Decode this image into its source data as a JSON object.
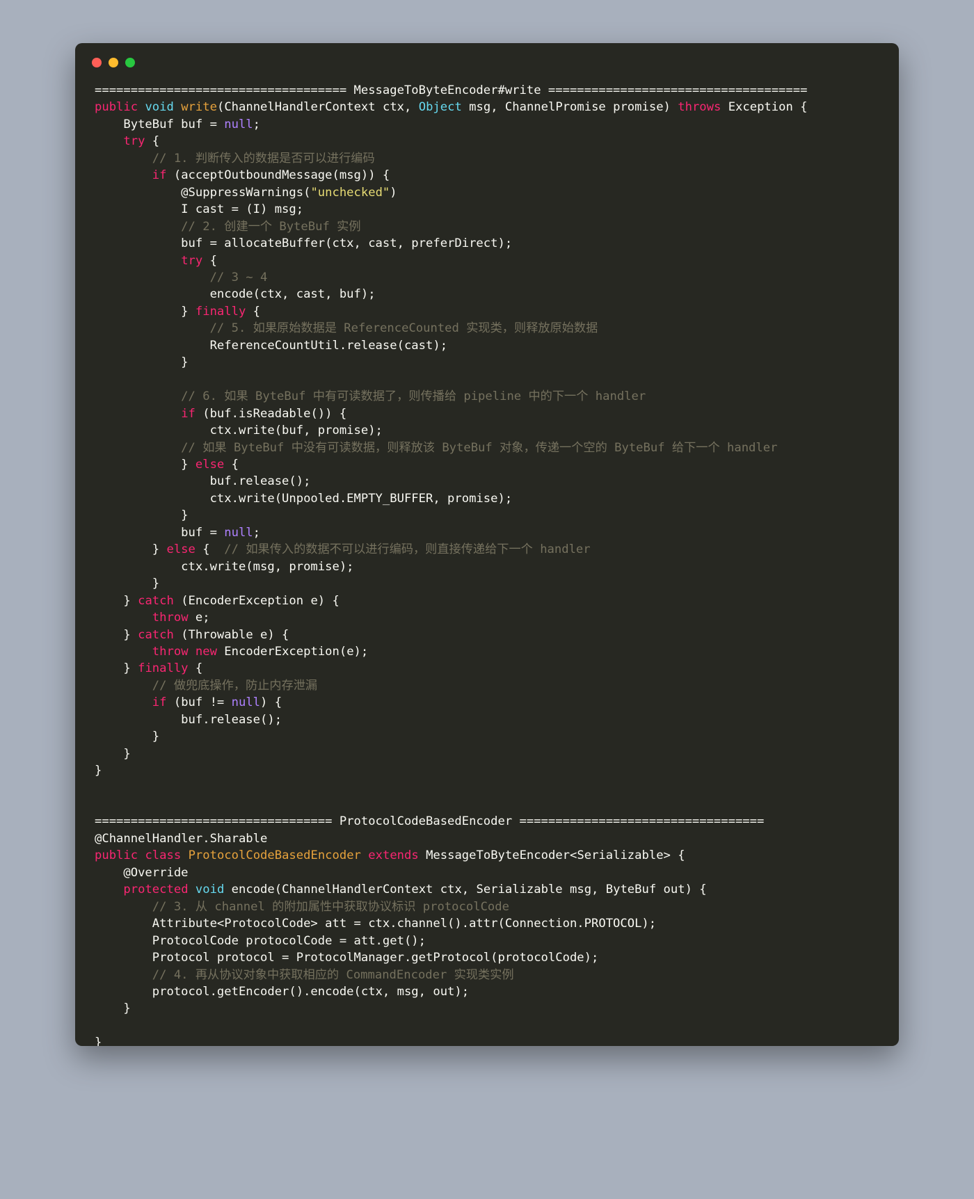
{
  "window": {
    "traffic_lights": [
      "close",
      "minimize",
      "zoom"
    ]
  },
  "code": {
    "lines": [
      {
        "id": "l1",
        "segments": [
          {
            "t": "=================================== MessageToByteEncoder#write ====================================",
            "c": "pl"
          }
        ]
      },
      {
        "id": "l2",
        "segments": [
          {
            "t": "public",
            "c": "kw"
          },
          {
            "t": " ",
            "c": "pl"
          },
          {
            "t": "void",
            "c": "ty"
          },
          {
            "t": " ",
            "c": "pl"
          },
          {
            "t": "write",
            "c": "fn"
          },
          {
            "t": "(ChannelHandlerContext ctx, ",
            "c": "pl"
          },
          {
            "t": "Object",
            "c": "ty"
          },
          {
            "t": " msg, ChannelPromise promise) ",
            "c": "pl"
          },
          {
            "t": "throws",
            "c": "kw"
          },
          {
            "t": " Exception {",
            "c": "pl"
          }
        ]
      },
      {
        "id": "l3",
        "segments": [
          {
            "t": "    ByteBuf buf = ",
            "c": "pl"
          },
          {
            "t": "null",
            "c": "nl"
          },
          {
            "t": ";",
            "c": "pl"
          }
        ]
      },
      {
        "id": "l4",
        "segments": [
          {
            "t": "    ",
            "c": "pl"
          },
          {
            "t": "try",
            "c": "kw"
          },
          {
            "t": " {",
            "c": "pl"
          }
        ]
      },
      {
        "id": "l5",
        "segments": [
          {
            "t": "        // 1. 判断传入的数据是否可以进行编码",
            "c": "cm"
          }
        ]
      },
      {
        "id": "l6",
        "segments": [
          {
            "t": "        ",
            "c": "pl"
          },
          {
            "t": "if",
            "c": "kw"
          },
          {
            "t": " (acceptOutboundMessage(msg)) {",
            "c": "pl"
          }
        ]
      },
      {
        "id": "l7",
        "segments": [
          {
            "t": "            @SuppressWarnings(",
            "c": "pl"
          },
          {
            "t": "\"unchecked\"",
            "c": "st"
          },
          {
            "t": ")",
            "c": "pl"
          }
        ]
      },
      {
        "id": "l8",
        "segments": [
          {
            "t": "            I cast = (I) msg;",
            "c": "pl"
          }
        ]
      },
      {
        "id": "l9",
        "segments": [
          {
            "t": "            // 2. 创建一个 ByteBuf 实例",
            "c": "cm"
          }
        ]
      },
      {
        "id": "l10",
        "segments": [
          {
            "t": "            buf = allocateBuffer(ctx, cast, preferDirect);",
            "c": "pl"
          }
        ]
      },
      {
        "id": "l11",
        "segments": [
          {
            "t": "            ",
            "c": "pl"
          },
          {
            "t": "try",
            "c": "kw"
          },
          {
            "t": " {",
            "c": "pl"
          }
        ]
      },
      {
        "id": "l12",
        "segments": [
          {
            "t": "                // 3 ~ 4",
            "c": "cm"
          }
        ]
      },
      {
        "id": "l13",
        "segments": [
          {
            "t": "                encode(ctx, cast, buf);",
            "c": "pl"
          }
        ]
      },
      {
        "id": "l14",
        "segments": [
          {
            "t": "            } ",
            "c": "pl"
          },
          {
            "t": "finally",
            "c": "kw"
          },
          {
            "t": " {",
            "c": "pl"
          }
        ]
      },
      {
        "id": "l15",
        "segments": [
          {
            "t": "                // 5. 如果原始数据是 ReferenceCounted 实现类，则释放原始数据",
            "c": "cm"
          }
        ]
      },
      {
        "id": "l16",
        "segments": [
          {
            "t": "                ReferenceCountUtil.release(cast);",
            "c": "pl"
          }
        ]
      },
      {
        "id": "l17",
        "segments": [
          {
            "t": "            }",
            "c": "pl"
          }
        ]
      },
      {
        "id": "l18",
        "segments": [
          {
            "t": "",
            "c": "pl"
          }
        ]
      },
      {
        "id": "l19",
        "segments": [
          {
            "t": "            // 6. 如果 ByteBuf 中有可读数据了，则传播给 pipeline 中的下一个 handler",
            "c": "cm"
          }
        ]
      },
      {
        "id": "l20",
        "segments": [
          {
            "t": "            ",
            "c": "pl"
          },
          {
            "t": "if",
            "c": "kw"
          },
          {
            "t": " (buf.isReadable()) {",
            "c": "pl"
          }
        ]
      },
      {
        "id": "l21",
        "segments": [
          {
            "t": "                ctx.write(buf, promise);",
            "c": "pl"
          }
        ]
      },
      {
        "id": "l22",
        "segments": [
          {
            "t": "            // 如果 ByteBuf 中没有可读数据，则释放该 ByteBuf 对象，传递一个空的 ByteBuf 给下一个 handler",
            "c": "cm"
          }
        ]
      },
      {
        "id": "l23",
        "segments": [
          {
            "t": "            } ",
            "c": "pl"
          },
          {
            "t": "else",
            "c": "kw"
          },
          {
            "t": " {",
            "c": "pl"
          }
        ]
      },
      {
        "id": "l24",
        "segments": [
          {
            "t": "                buf.release();",
            "c": "pl"
          }
        ]
      },
      {
        "id": "l25",
        "segments": [
          {
            "t": "                ctx.write(Unpooled.EMPTY_BUFFER, promise);",
            "c": "pl"
          }
        ]
      },
      {
        "id": "l26",
        "segments": [
          {
            "t": "            }",
            "c": "pl"
          }
        ]
      },
      {
        "id": "l27",
        "segments": [
          {
            "t": "            buf = ",
            "c": "pl"
          },
          {
            "t": "null",
            "c": "nl"
          },
          {
            "t": ";",
            "c": "pl"
          }
        ]
      },
      {
        "id": "l28",
        "segments": [
          {
            "t": "        } ",
            "c": "pl"
          },
          {
            "t": "else",
            "c": "kw"
          },
          {
            "t": " {  ",
            "c": "pl"
          },
          {
            "t": "// 如果传入的数据不可以进行编码，则直接传递给下一个 handler",
            "c": "cm"
          }
        ]
      },
      {
        "id": "l29",
        "segments": [
          {
            "t": "            ctx.write(msg, promise);",
            "c": "pl"
          }
        ]
      },
      {
        "id": "l30",
        "segments": [
          {
            "t": "        }",
            "c": "pl"
          }
        ]
      },
      {
        "id": "l31",
        "segments": [
          {
            "t": "    } ",
            "c": "pl"
          },
          {
            "t": "catch",
            "c": "kw"
          },
          {
            "t": " (EncoderException e) {",
            "c": "pl"
          }
        ]
      },
      {
        "id": "l32",
        "segments": [
          {
            "t": "        ",
            "c": "pl"
          },
          {
            "t": "throw",
            "c": "kw"
          },
          {
            "t": " e;",
            "c": "pl"
          }
        ]
      },
      {
        "id": "l33",
        "segments": [
          {
            "t": "    } ",
            "c": "pl"
          },
          {
            "t": "catch",
            "c": "kw"
          },
          {
            "t": " (Throwable e) {",
            "c": "pl"
          }
        ]
      },
      {
        "id": "l34",
        "segments": [
          {
            "t": "        ",
            "c": "pl"
          },
          {
            "t": "throw",
            "c": "kw"
          },
          {
            "t": " ",
            "c": "pl"
          },
          {
            "t": "new",
            "c": "kw"
          },
          {
            "t": " EncoderException(e);",
            "c": "pl"
          }
        ]
      },
      {
        "id": "l35",
        "segments": [
          {
            "t": "    } ",
            "c": "pl"
          },
          {
            "t": "finally",
            "c": "kw"
          },
          {
            "t": " {",
            "c": "pl"
          }
        ]
      },
      {
        "id": "l36",
        "segments": [
          {
            "t": "        // 做兜底操作，防止内存泄漏",
            "c": "cm"
          }
        ]
      },
      {
        "id": "l37",
        "segments": [
          {
            "t": "        ",
            "c": "pl"
          },
          {
            "t": "if",
            "c": "kw"
          },
          {
            "t": " (buf != ",
            "c": "pl"
          },
          {
            "t": "null",
            "c": "nl"
          },
          {
            "t": ") {",
            "c": "pl"
          }
        ]
      },
      {
        "id": "l38",
        "segments": [
          {
            "t": "            buf.release();",
            "c": "pl"
          }
        ]
      },
      {
        "id": "l39",
        "segments": [
          {
            "t": "        }",
            "c": "pl"
          }
        ]
      },
      {
        "id": "l40",
        "segments": [
          {
            "t": "    }",
            "c": "pl"
          }
        ]
      },
      {
        "id": "l41",
        "segments": [
          {
            "t": "}",
            "c": "pl"
          }
        ]
      },
      {
        "id": "l42",
        "segments": [
          {
            "t": "",
            "c": "pl"
          }
        ]
      },
      {
        "id": "l43",
        "segments": [
          {
            "t": "",
            "c": "pl"
          }
        ]
      },
      {
        "id": "l44",
        "segments": [
          {
            "t": "================================= ProtocolCodeBasedEncoder ==================================",
            "c": "pl"
          }
        ]
      },
      {
        "id": "l45",
        "segments": [
          {
            "t": "@ChannelHandler.Sharable",
            "c": "pl"
          }
        ]
      },
      {
        "id": "l46",
        "segments": [
          {
            "t": "public",
            "c": "kw"
          },
          {
            "t": " ",
            "c": "pl"
          },
          {
            "t": "class",
            "c": "kw"
          },
          {
            "t": " ",
            "c": "pl"
          },
          {
            "t": "ProtocolCodeBasedEncoder",
            "c": "fn"
          },
          {
            "t": " ",
            "c": "pl"
          },
          {
            "t": "extends",
            "c": "kw"
          },
          {
            "t": " MessageToByteEncoder<Serializable> {",
            "c": "pl"
          }
        ]
      },
      {
        "id": "l47",
        "segments": [
          {
            "t": "    @Override",
            "c": "pl"
          }
        ]
      },
      {
        "id": "l48",
        "segments": [
          {
            "t": "    ",
            "c": "pl"
          },
          {
            "t": "protected",
            "c": "kw"
          },
          {
            "t": " ",
            "c": "pl"
          },
          {
            "t": "void",
            "c": "ty"
          },
          {
            "t": " encode(ChannelHandlerContext ctx, Serializable msg, ByteBuf out) {",
            "c": "pl"
          }
        ]
      },
      {
        "id": "l49",
        "segments": [
          {
            "t": "        // 3. 从 channel 的附加属性中获取协议标识 protocolCode",
            "c": "cm"
          }
        ]
      },
      {
        "id": "l50",
        "segments": [
          {
            "t": "        Attribute<ProtocolCode> att = ctx.channel().attr(Connection.PROTOCOL);",
            "c": "pl"
          }
        ]
      },
      {
        "id": "l51",
        "segments": [
          {
            "t": "        ProtocolCode protocolCode = att.get();",
            "c": "pl"
          }
        ]
      },
      {
        "id": "l52",
        "segments": [
          {
            "t": "        Protocol protocol = ProtocolManager.getProtocol(protocolCode);",
            "c": "pl"
          }
        ]
      },
      {
        "id": "l53",
        "segments": [
          {
            "t": "        // 4. 再从协议对象中获取相应的 CommandEncoder 实现类实例",
            "c": "cm"
          }
        ]
      },
      {
        "id": "l54",
        "segments": [
          {
            "t": "        protocol.getEncoder().encode(ctx, msg, out);",
            "c": "pl"
          }
        ]
      },
      {
        "id": "l55",
        "segments": [
          {
            "t": "    }",
            "c": "pl"
          }
        ]
      },
      {
        "id": "l56",
        "segments": [
          {
            "t": "",
            "c": "pl"
          }
        ]
      },
      {
        "id": "l57",
        "segments": [
          {
            "t": "}",
            "c": "pl"
          }
        ]
      }
    ]
  },
  "colors": {
    "background": "#a8b0bd",
    "window_background": "#272822",
    "foreground": "#f8f8f2",
    "keyword": "#f92672",
    "type": "#66d9ef",
    "function": "#e6a23c",
    "comment": "#75715e",
    "string": "#e6db74",
    "constant": "#ae81ff",
    "dot_red": "#ff5f57",
    "dot_yellow": "#febc2e",
    "dot_green": "#28c840"
  }
}
